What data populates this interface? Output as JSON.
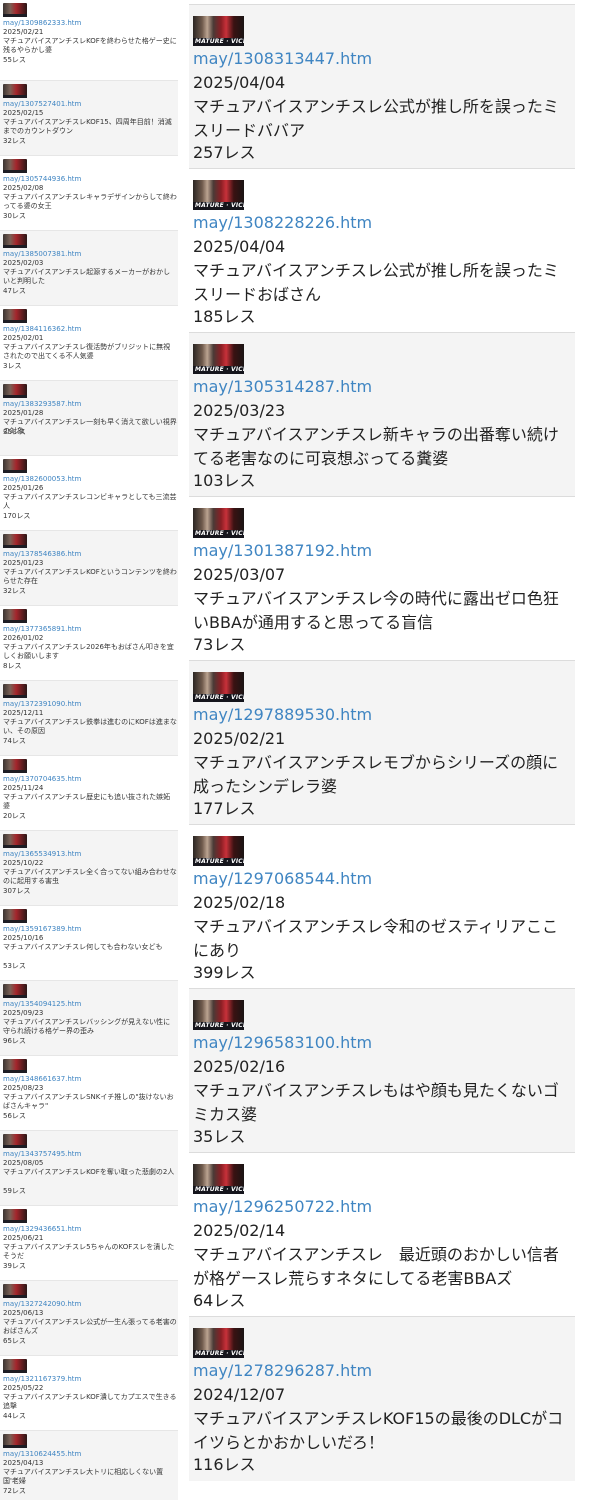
{
  "left_entries": [
    {
      "link": "may/1309862333.htm",
      "date": "2025/02/21",
      "title": "マチュアバイスアンチスレKOFを終わらせた格ゲー史に残るやらかし婆",
      "count": "55レス"
    },
    {
      "link": "may/1307527401.htm",
      "date": "2025/02/15",
      "title": "マチュアバイスアンチスレKOF15、四周年目前！消滅までのカウントダウン",
      "count": "32レス"
    },
    {
      "link": "may/1305744936.htm",
      "date": "2025/02/08",
      "title": "マチュアバイスアンチスレキャラデザインからして終わってる婆の女王",
      "count": "30レス"
    },
    {
      "link": "may/1385007381.htm",
      "date": "2025/02/03",
      "title": "マチュアバイスアンチスレ起源するメーカーがおかしいと判明した",
      "count": "47レス"
    },
    {
      "link": "may/1384116362.htm",
      "date": "2025/02/01",
      "title": "マチュアバイスアンチスレ復活勢がブリジットに無視されたので出てくる不人気婆",
      "count": "3レス"
    },
    {
      "link": "may/1383293587.htm",
      "date": "2025/01/28",
      "title": "マチュアバイスアンチスレ一刻も早く消えて欲しい視界の対象",
      "count": "35レス"
    },
    {
      "link": "may/1382600053.htm",
      "date": "2025/01/26",
      "title": "マチュアバイスアンチスレコンビキャラとしても三流芸人",
      "count": "170レス"
    },
    {
      "link": "may/1378546386.htm",
      "date": "2025/01/23",
      "title": "マチュアバイスアンチスレKOFというコンテンツを終わらせた存在",
      "count": "32レス"
    },
    {
      "link": "may/1377365891.htm",
      "date": "2026/01/02",
      "title": "マチュアバイスアンチスレ2026年もおばさん叩きを宜しくお願いします",
      "count": "8レス"
    },
    {
      "link": "may/1372391090.htm",
      "date": "2025/12/11",
      "title": "マチュアバイスアンチスレ鉄拳は進むのにKOFは進まない、その原因",
      "count": "74レス"
    },
    {
      "link": "may/1370704635.htm",
      "date": "2025/11/24",
      "title": "マチュアバイスアンチスレ歴史にも追い抜された嫉妬婆",
      "count": "20レス"
    },
    {
      "link": "may/1365534913.htm",
      "date": "2025/10/22",
      "title": "マチュアバイスアンチスレ全く合ってない組み合わせなのに起用する害虫",
      "count": "307レス"
    },
    {
      "link": "may/1359167389.htm",
      "date": "2025/10/16",
      "title": "マチュアバイスアンチスレ何しても合わない女ども",
      "count": "53レス"
    },
    {
      "link": "may/1354094125.htm",
      "date": "2025/09/23",
      "title": "マチュアバイスアンチスレバッシングが見えない性に守られ続ける格ゲー界の歪み",
      "count": "96レス"
    },
    {
      "link": "may/1348661637.htm",
      "date": "2025/08/23",
      "title": "マチュアバイスアンチスレSNKイチ推しの\"抜けないおばさんキャラ\"",
      "count": "56レス"
    },
    {
      "link": "may/1343757495.htm",
      "date": "2025/08/05",
      "title": "マチュアバイスアンチスレKOFを奪い取った悲劇の2人",
      "count": "59レス"
    },
    {
      "link": "may/1329436651.htm",
      "date": "2025/06/21",
      "title": "マチュアバイスアンチスレ5ちゃんのKOFスレを漬したそうだ",
      "count": "39レス"
    },
    {
      "link": "may/1327242090.htm",
      "date": "2025/06/13",
      "title": "マチュアバイスアンチスレ公式が一生ん張ってる老害のおばさんズ",
      "count": "65レス"
    },
    {
      "link": "may/1321167379.htm",
      "date": "2025/05/22",
      "title": "マチュアバイスアンチスレKOF潰してカプエスで生きる追撃",
      "count": "44レス"
    },
    {
      "link": "may/1310624455.htm",
      "date": "2025/04/13",
      "title": "マチュアバイスアンチスレ大トリに相応しくない置国'老婦",
      "count": "72レス"
    }
  ],
  "right_entries": [
    {
      "thumb_text": "MATURE · VICE",
      "link": "may/1308313447.htm",
      "date": "2025/04/04",
      "title": "マチュアバイスアンチスレ公式が推し所を誤ったミスリードババア",
      "count": "257レス"
    },
    {
      "thumb_text": "MATURE · VICE",
      "link": "may/1308228226.htm",
      "date": "2025/04/04",
      "title": "マチュアバイスアンチスレ公式が推し所を誤ったミスリードおばさん",
      "count": "185レス"
    },
    {
      "thumb_text": "MATURE · VICE",
      "link": "may/1305314287.htm",
      "date": "2025/03/23",
      "title": "マチュアバイスアンチスレ新キャラの出番奪い続けてる老害なのに可哀想ぶってる糞婆",
      "count": "103レス"
    },
    {
      "thumb_text": "MATURE · VICE",
      "link": "may/1301387192.htm",
      "date": "2025/03/07",
      "title": "マチュアバイスアンチスレ今の時代に露出ゼロ色狂いBBAが通用すると思ってる盲信",
      "count": "73レス"
    },
    {
      "thumb_text": "MATURE · VICE",
      "link": "may/1297889530.htm",
      "date": "2025/02/21",
      "title": "マチュアバイスアンチスレモブからシリーズの顔に成ったシンデレラ婆",
      "count": "177レス"
    },
    {
      "thumb_text": "MATURE · VICE",
      "link": "may/1297068544.htm",
      "date": "2025/02/18",
      "title": "マチュアバイスアンチスレ令和のゼスティリアここにあり",
      "count": "399レス"
    },
    {
      "thumb_text": "MATURE · VICE",
      "link": "may/1296583100.htm",
      "date": "2025/02/16",
      "title": "マチュアバイスアンチスレもはや顔も見たくないゴミカス婆",
      "count": "35レス"
    },
    {
      "thumb_text": "MATURE · VICE",
      "link": "may/1296250722.htm",
      "date": "2025/02/14",
      "title": "マチュアバイスアンチスレ　最近頭のおかしい信者が格ゲースレ荒らすネタにしてる老害BBAズ",
      "count": "64レス"
    },
    {
      "thumb_text": "MATURE · VICE",
      "link": "may/1278296287.htm",
      "date": "2024/12/07",
      "title": "マチュアバイスアンチスレKOF15の最後のDLCがコイツらとかおかしいだろ！",
      "count": "116レス"
    }
  ]
}
